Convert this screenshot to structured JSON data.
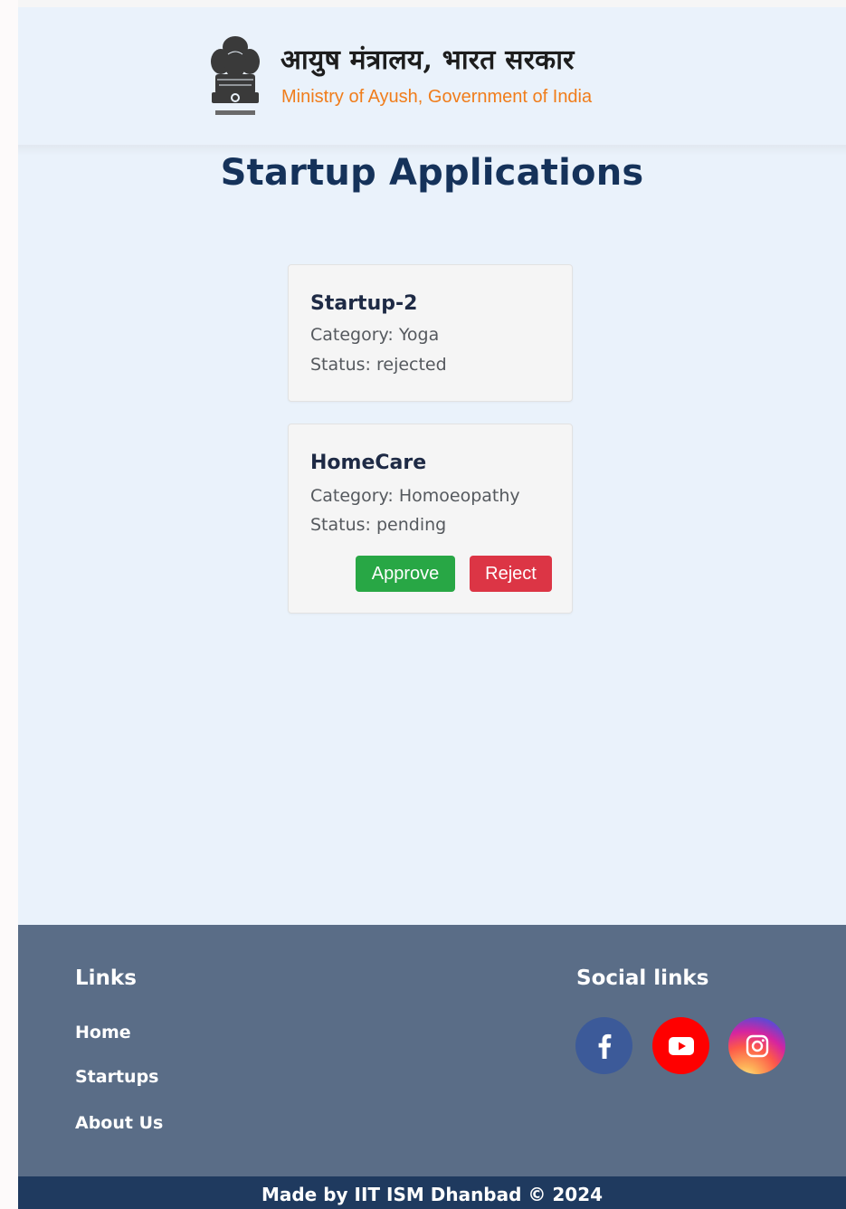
{
  "header": {
    "hindi_title": "आयुष मंत्रालय, भारत सरकार",
    "english_title": "Ministry of Ayush, Government of India",
    "accent_color": "#f07d1b"
  },
  "main": {
    "title": "Startup Applications",
    "applications": [
      {
        "name": "Startup-2",
        "category_line": "Category: Yoga",
        "status_line": "Status: rejected"
      },
      {
        "name": "HomeCare",
        "category_line": "Category: Homoeopathy",
        "status_line": "Status: pending",
        "approve_label": "Approve",
        "reject_label": "Reject"
      }
    ]
  },
  "footer": {
    "links_heading": "Links",
    "links": [
      "Home",
      "Startups",
      "About Us"
    ],
    "social_heading": "Social links",
    "social_icons": [
      "facebook-icon",
      "youtube-icon",
      "instagram-icon"
    ],
    "copyright": "Made by IIT ISM Dhanbad © 2024"
  }
}
